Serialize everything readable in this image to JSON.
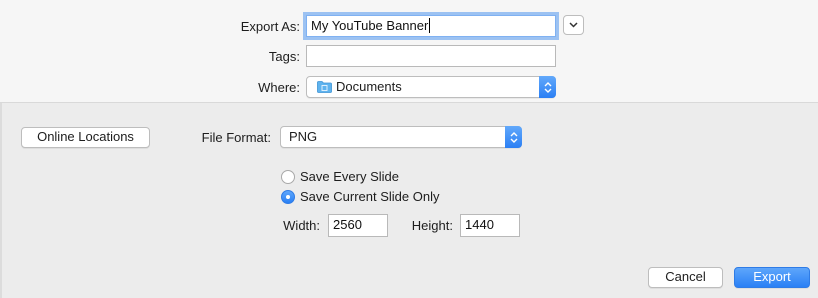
{
  "dialog": {
    "export_as_label": "Export As:",
    "export_as_value": "My YouTube Banner",
    "tags_label": "Tags:",
    "tags_value": "",
    "where_label": "Where:",
    "where_value": "Documents",
    "online_locations_label": "Online Locations",
    "file_format_label": "File Format:",
    "file_format_value": "PNG",
    "save_options": [
      {
        "label": "Save Every Slide",
        "selected": false
      },
      {
        "label": "Save Current Slide Only",
        "selected": true
      }
    ],
    "width_label": "Width:",
    "width_value": "2560",
    "height_label": "Height:",
    "height_value": "1440",
    "cancel_label": "Cancel",
    "export_label": "Export"
  },
  "icons": {
    "expand": "chevron-down-icon",
    "folder": "folder-icon",
    "stepper": "up-down-arrows-icon"
  },
  "colors": {
    "accent": "#2a80f5",
    "focus_ring": "#5297ee",
    "top_panel": "#f6f6f6",
    "bottom_panel": "#ececec"
  }
}
